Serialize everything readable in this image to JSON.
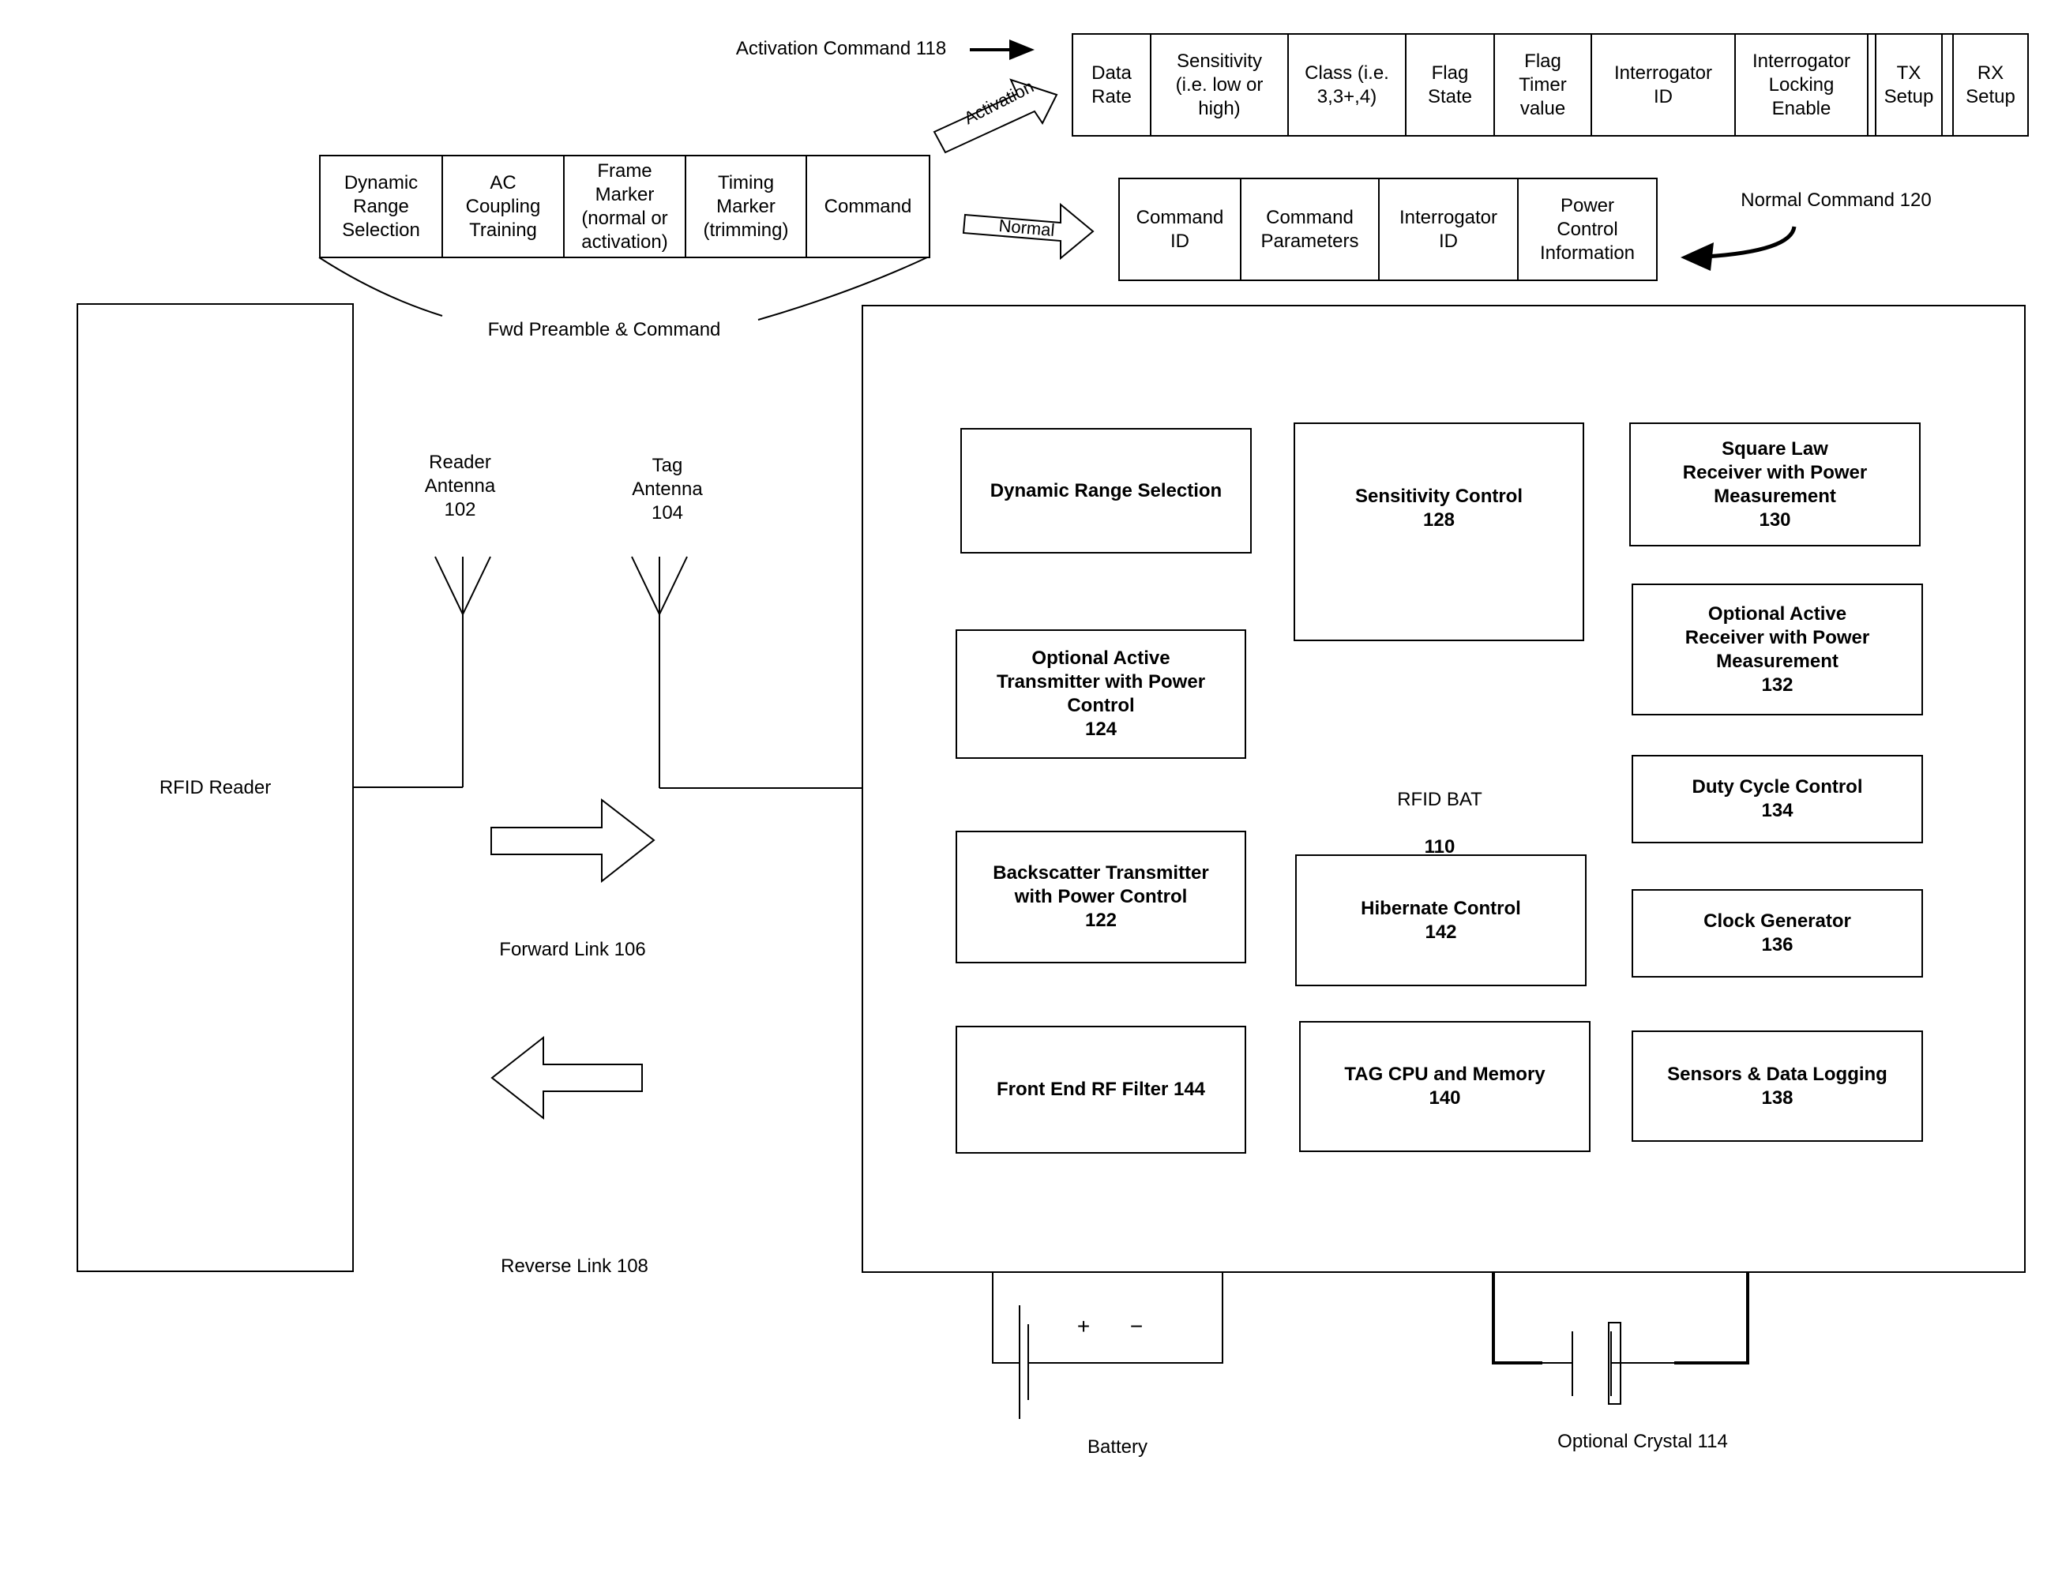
{
  "activation_command": {
    "label": "Activation Command 118",
    "arrow_label": "Activation",
    "fields": [
      "Data\nRate",
      "Sensitivity\n(i.e. low or\nhigh)",
      "Class (i.e.\n3,3+,4)",
      "Flag\nState",
      "Flag\nTimer\nvalue",
      "Interrogator\nID",
      "Interrogator\nLocking\nEnable",
      "TX\nSetup",
      "RX\nSetup"
    ]
  },
  "forward_preamble": {
    "label": "Fwd Preamble & Command",
    "fields": [
      "Dynamic\nRange\nSelection",
      "AC\nCoupling\nTraining",
      "Frame\nMarker\n(normal or\nactivation)",
      "Timing\nMarker\n(trimming)",
      "Command"
    ]
  },
  "normal_command": {
    "label": "Normal Command 120",
    "arrow_label": "Normal",
    "fields": [
      "Command\nID",
      "Command\nParameters",
      "Interrogator\nID",
      "Power\nControl\nInformation"
    ]
  },
  "reader": {
    "label": "RFID Reader",
    "antenna_label": "Reader\nAntenna\n102"
  },
  "tag_antenna_label": "Tag\nAntenna\n104",
  "links": {
    "forward": "Forward Link 106",
    "reverse": "Reverse Link 108"
  },
  "bat": {
    "name": "RFID BAT",
    "number": "110",
    "blocks": {
      "dynamic_range": "Dynamic Range Selection",
      "sensitivity": "Sensitivity Control\n128",
      "square_law": "Square Law\nReceiver with Power\nMeasurement\n130",
      "active_tx": "Optional Active\nTransmitter with Power\nControl\n124",
      "active_rx": "Optional Active\nReceiver with Power\nMeasurement\n132",
      "duty_cycle": "Duty Cycle Control\n134",
      "backscatter": "Backscatter Transmitter\nwith Power Control\n122",
      "hibernate": "Hibernate Control\n142",
      "clock": "Clock Generator\n136",
      "rf_filter": "Front End RF Filter 144",
      "cpu": "TAG CPU and Memory\n140",
      "sensors": "Sensors & Data Logging\n138"
    }
  },
  "battery": {
    "label": "Battery",
    "plus": "+",
    "minus": "−"
  },
  "crystal": {
    "label": "Optional Crystal 114"
  }
}
